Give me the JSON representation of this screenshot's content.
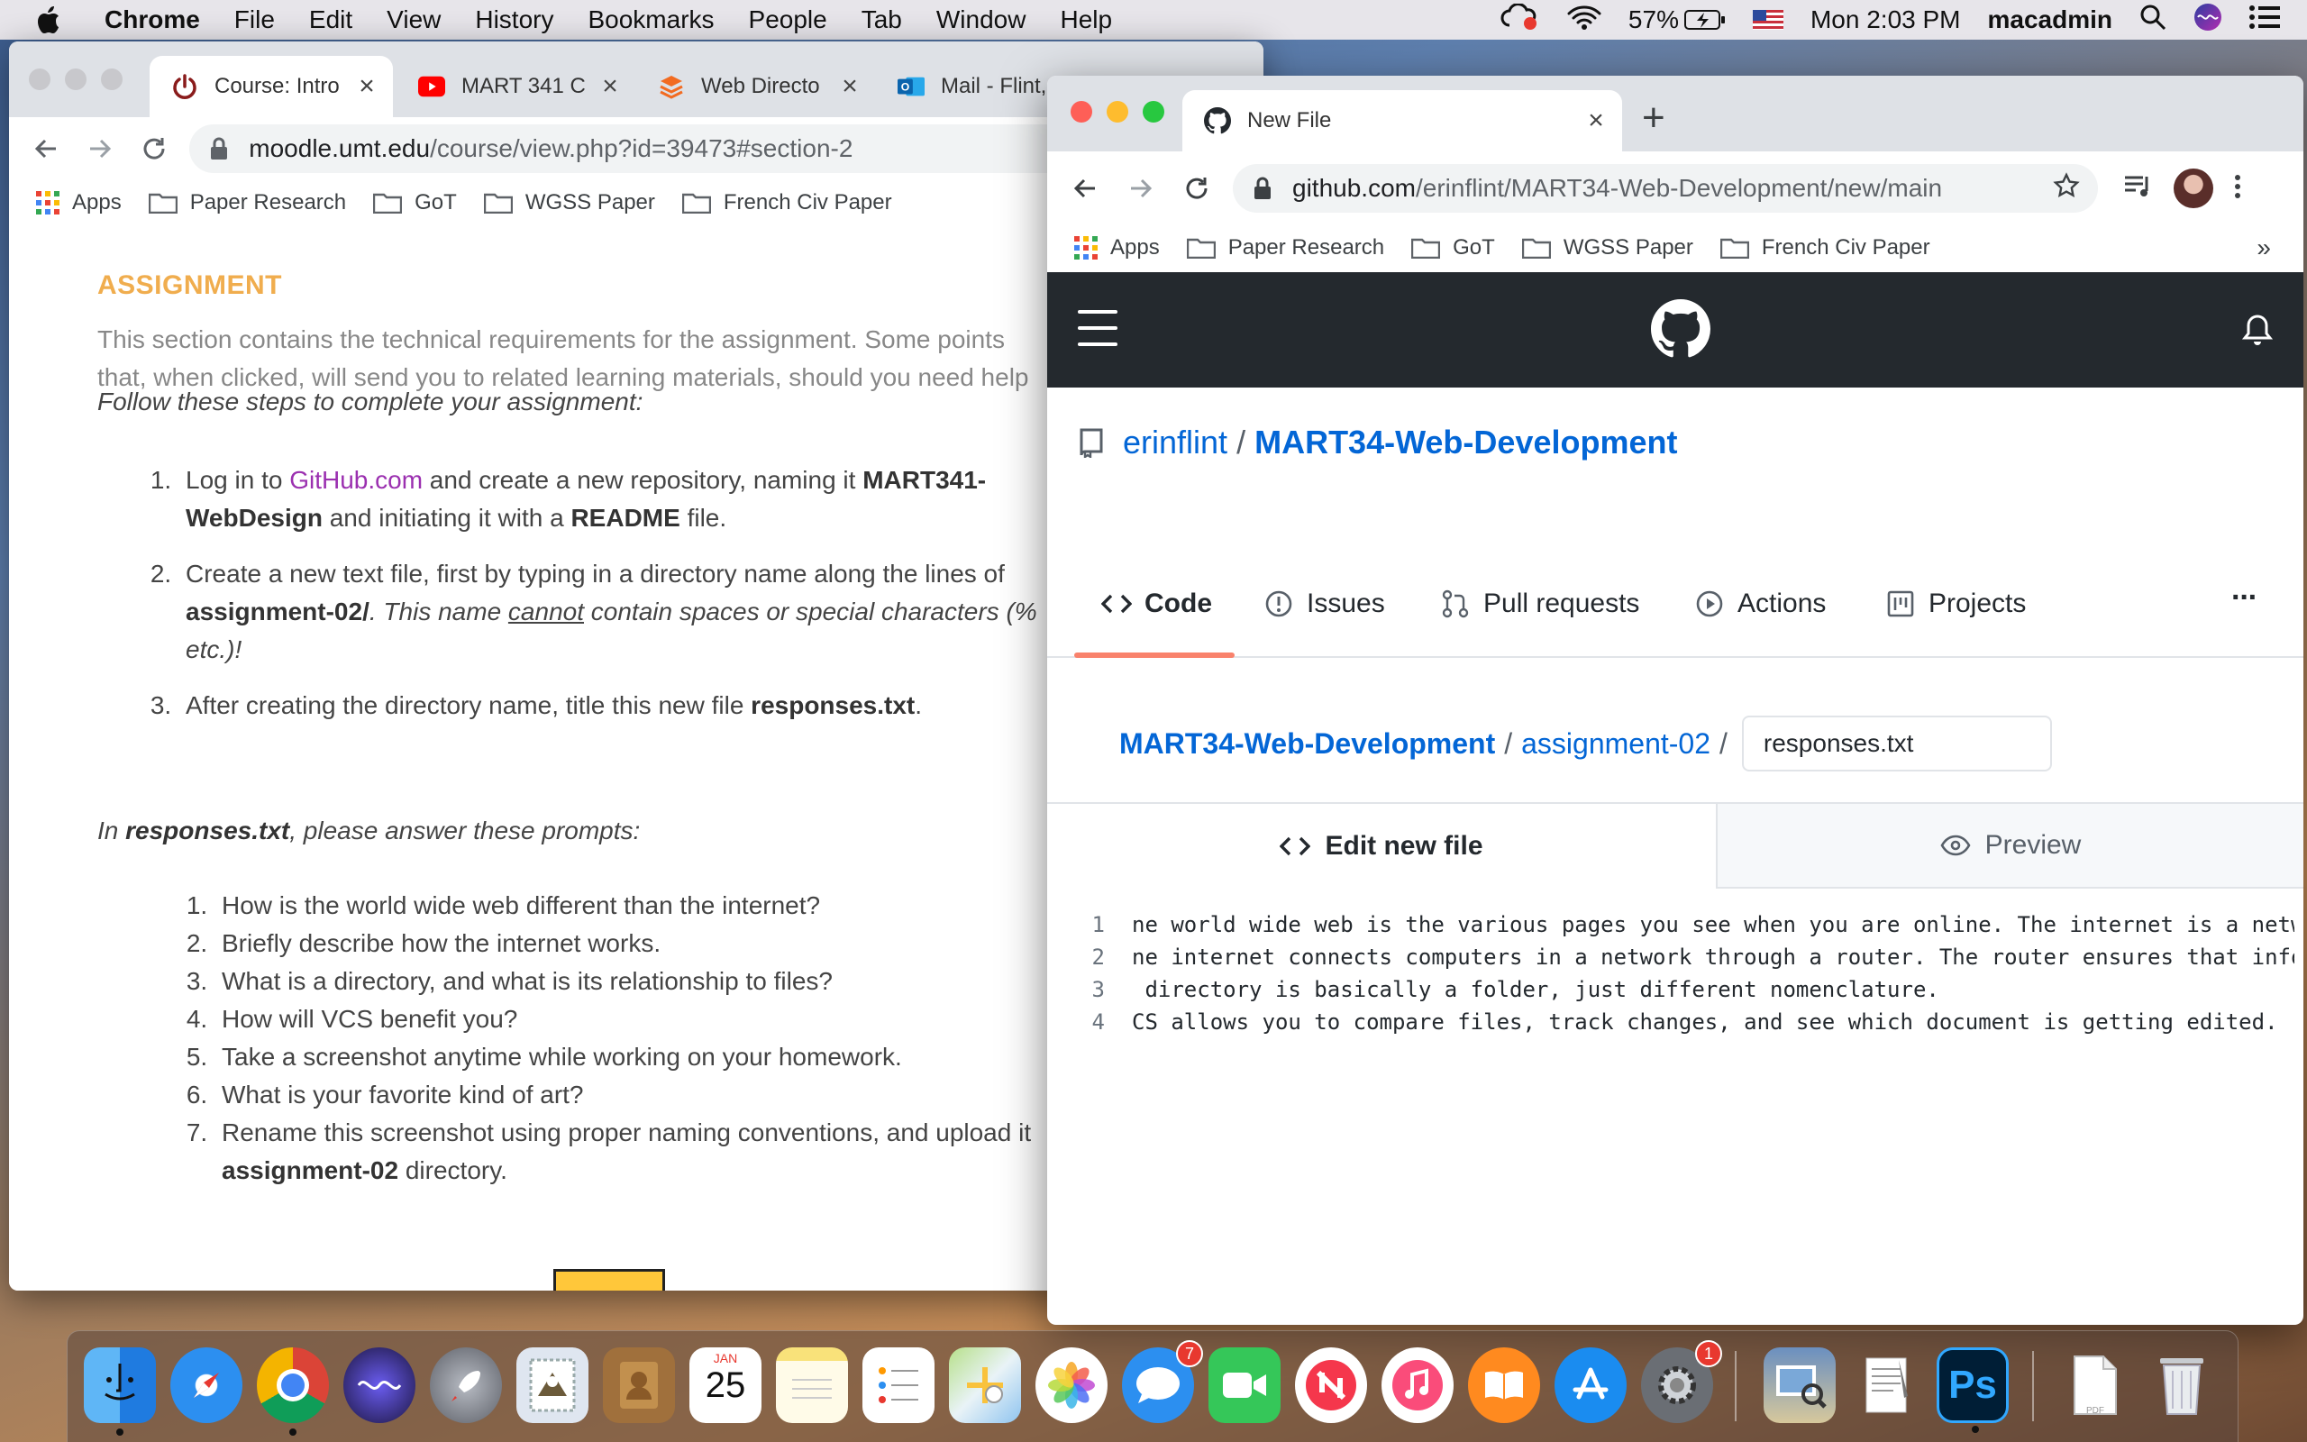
{
  "menubar": {
    "app": "Chrome",
    "items": [
      "File",
      "Edit",
      "View",
      "History",
      "Bookmarks",
      "People",
      "Tab",
      "Window",
      "Help"
    ],
    "battery": "57%",
    "clock": "Mon 2:03 PM",
    "user": "macadmin"
  },
  "left_window": {
    "tabs": [
      {
        "title": "Course: Intro"
      },
      {
        "title": "MART 341 C"
      },
      {
        "title": "Web Directo"
      },
      {
        "title": "Mail - Flint,"
      }
    ],
    "url_host": "moodle.umt.edu",
    "url_path": "/course/view.php?id=39473#section-2",
    "bookmarks": [
      "Apps",
      "Paper Research",
      "GoT",
      "WGSS Paper",
      "French Civ Paper"
    ],
    "content": {
      "heading": "ASSIGNMENT",
      "intro_line1": "This section contains the technical requirements for the assignment. Some points",
      "intro_line2": "that, when clicked, will send you to related learning materials, should you need help",
      "steps_intro": "Follow these steps to complete your assignment:",
      "step1_a": "Log in to ",
      "step1_link": "GitHub.com",
      "step1_b": " and create a new repository, naming it ",
      "step1_repo": "MART341-WebDesign",
      "step1_c": " and initiating it with a ",
      "step1_readme": "README",
      "step1_d": " file.",
      "step2_a": "Create a new text file, first by typing in a directory name along the lines of ",
      "step2_dir": "assignment-02/",
      "step2_b": ". This name ",
      "step2_cannot": "cannot",
      "step2_c": " contain spaces or special characters (%",
      "step2_d": "etc.)!",
      "step3_a": "After creating the directory name, title this new file ",
      "step3_file": "responses.txt",
      "step3_b": ".",
      "prompts_intro_a": "In ",
      "prompts_intro_file": "responses.txt",
      "prompts_intro_b": ", please answer these prompts:",
      "prompts": [
        "How is the world wide web different than the internet?",
        "Briefly describe how the internet works.",
        "What is a directory, and what is its relationship to files?",
        "How will VCS benefit you?",
        "Take a screenshot anytime while working on your homework.",
        "What is your favorite kind of art?"
      ],
      "prompt7_a": "Rename this screenshot using proper naming conventions, and upload it",
      "prompt7_dir": "assignment-02",
      "prompt7_b": " directory."
    }
  },
  "right_window": {
    "tab_title": "New File",
    "url_host": "github.com",
    "url_path": "/erinflint/MART34-Web-Development/new/main",
    "bookmarks": [
      "Apps",
      "Paper Research",
      "GoT",
      "WGSS Paper",
      "French Civ Paper"
    ],
    "bookmarks_overflow": "»",
    "repo_owner": "erinflint",
    "repo_name": "MART34-Web-Development",
    "nav": [
      "Code",
      "Issues",
      "Pull requests",
      "Actions",
      "Projects"
    ],
    "more": "···",
    "breadcrumb": [
      "MART34-Web-Development",
      "assignment-02"
    ],
    "filename": "responses.txt",
    "editor_tabs": {
      "edit": "Edit new file",
      "preview": "Preview"
    },
    "code_lines": [
      {
        "n": "1",
        "text": "ne world wide web is the various pages you see when you are online. The internet is a netw"
      },
      {
        "n": "2",
        "text": "ne internet connects computers in a network through a router. The router ensures that info"
      },
      {
        "n": "3",
        "text": " directory is basically a folder, just different nomenclature."
      },
      {
        "n": "4",
        "text": "CS allows you to compare files, track changes, and see which document is getting edited."
      }
    ]
  },
  "dock": {
    "calendar_month": "JAN",
    "calendar_day": "25",
    "messages_badge": "7",
    "prefs_badge": "1",
    "ps_label": "Ps",
    "pdf_label": "PDF"
  },
  "colors": {
    "github_header": "#24292e",
    "github_link": "#0366d6",
    "assignment_heading": "#f0ad4e",
    "code_tab_underline": "#f9826c"
  }
}
